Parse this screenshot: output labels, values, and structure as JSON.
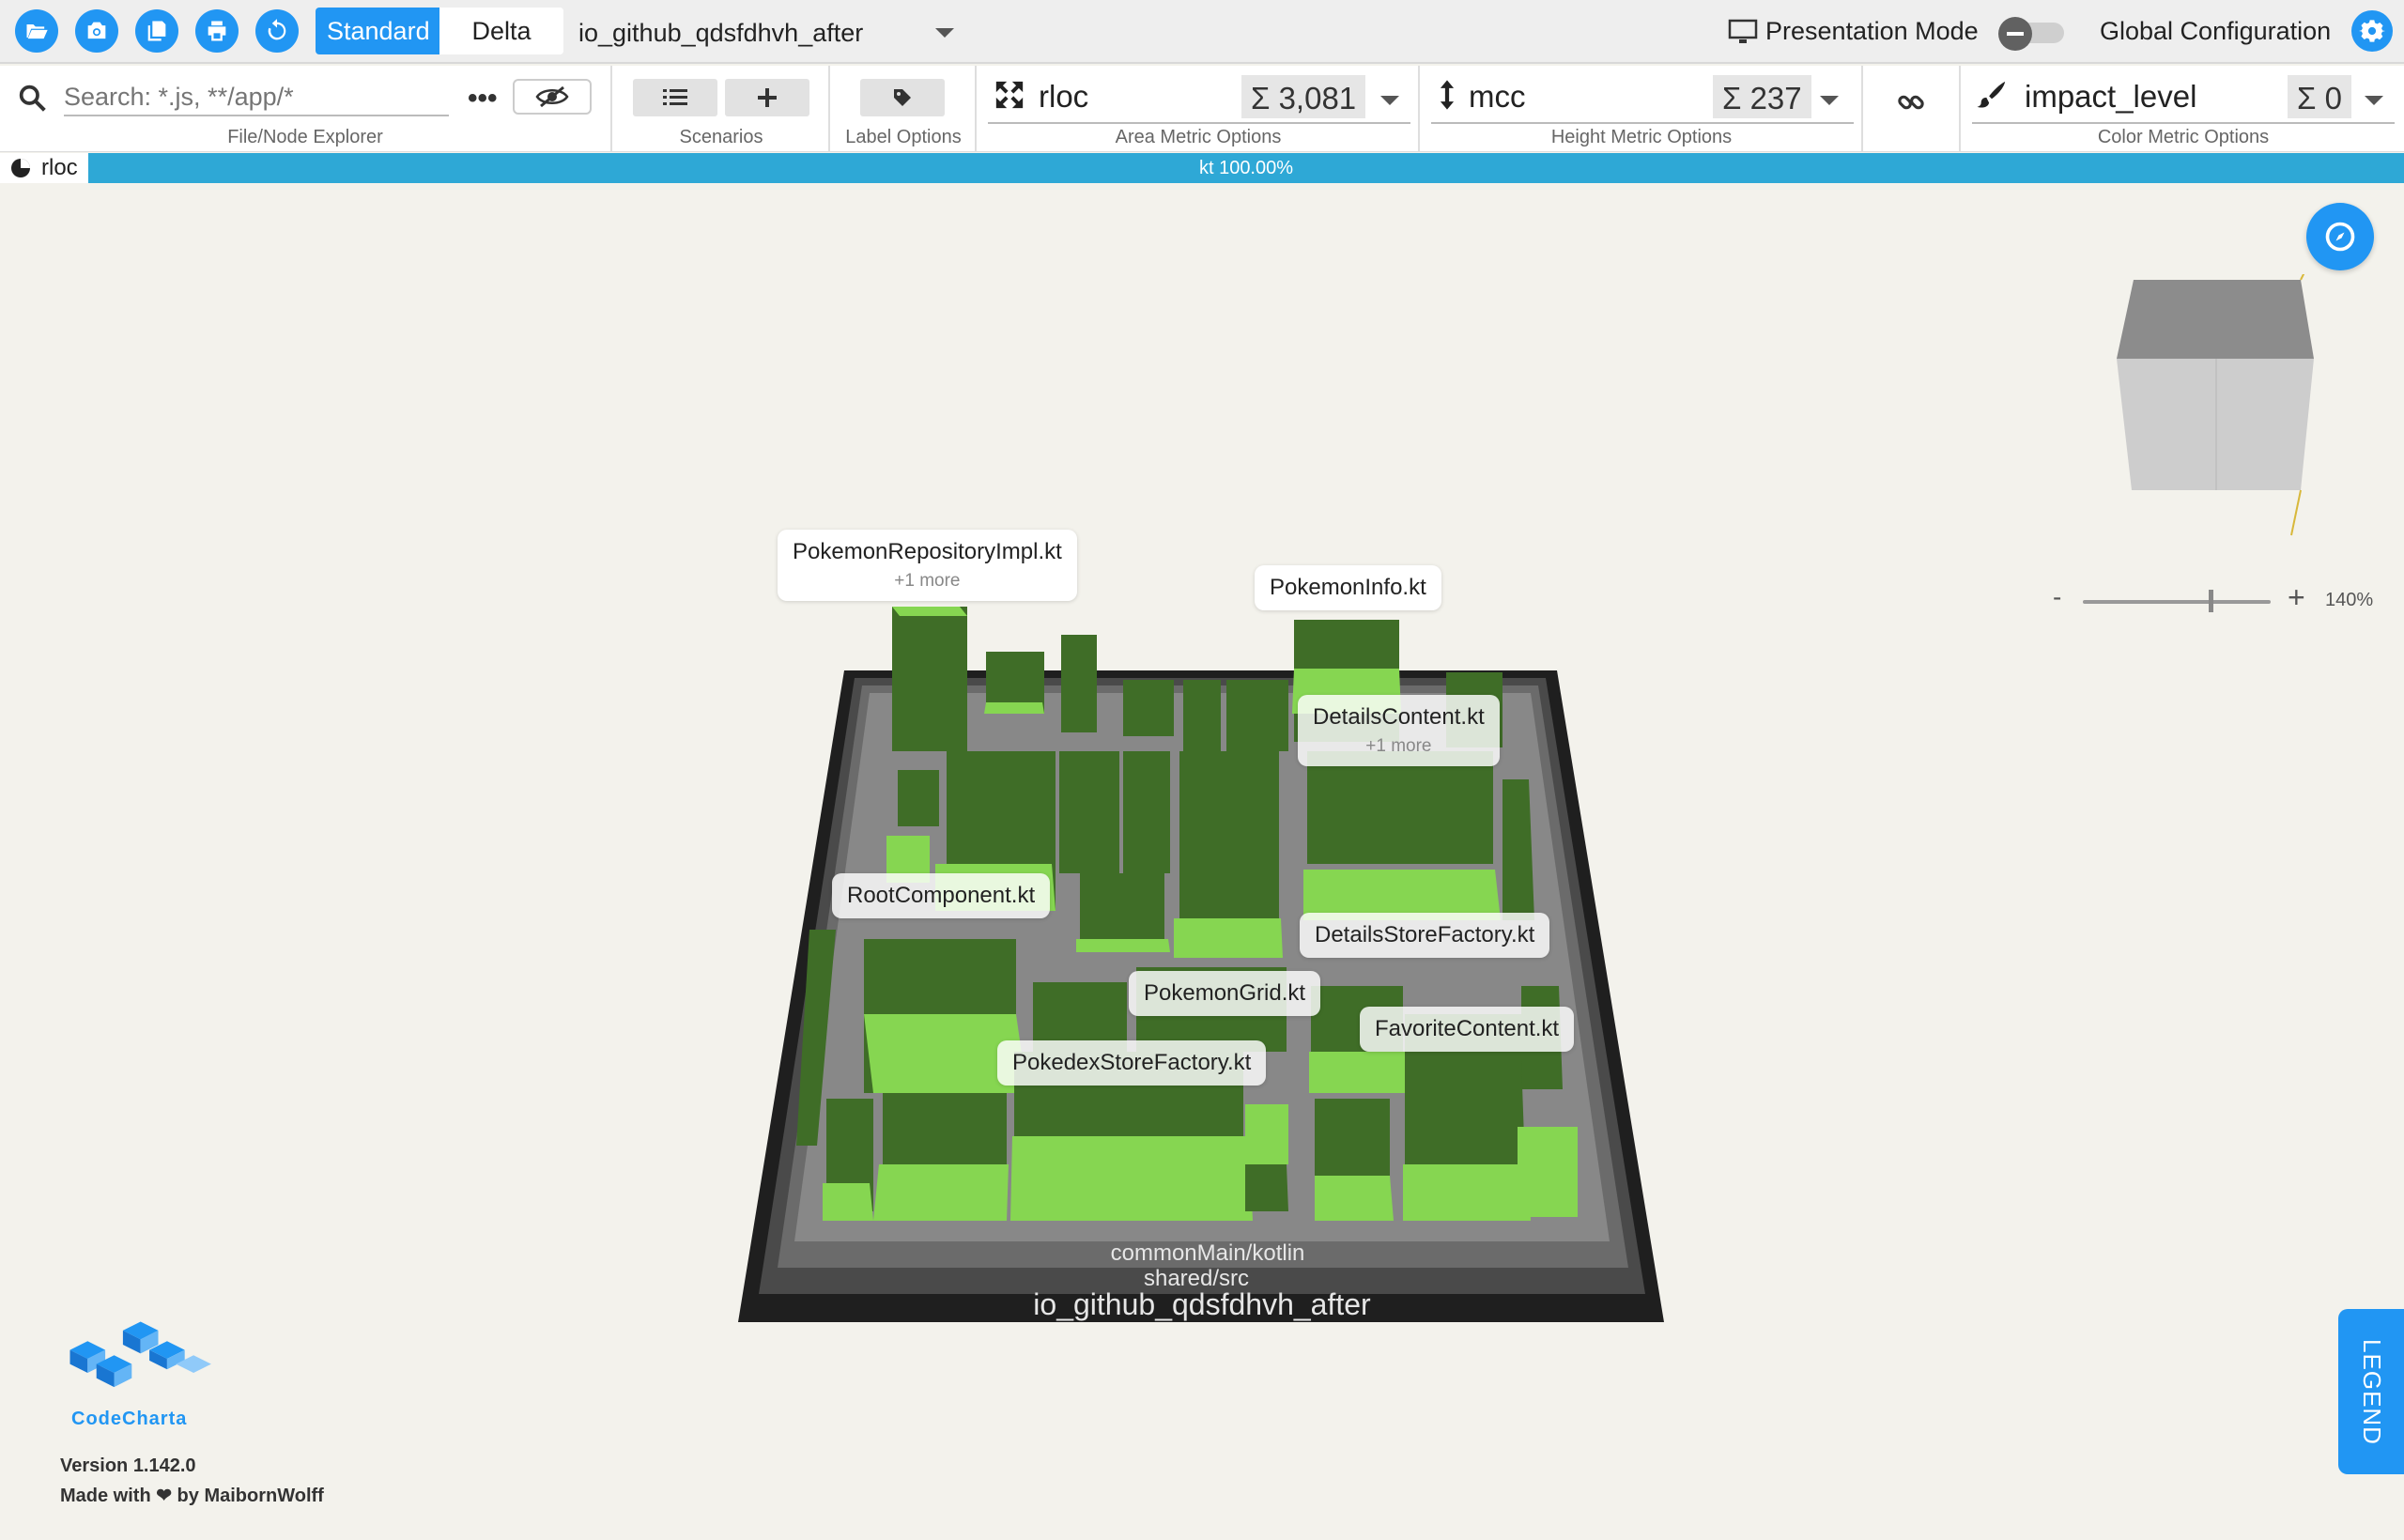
{
  "toolbar": {
    "icons": [
      "folder-open-icon",
      "camera-icon",
      "copy-icon",
      "print-icon",
      "reset-icon"
    ],
    "mode_standard": "Standard",
    "mode_delta": "Delta",
    "selected_file": "io_github_qdsfdhvh_after",
    "presentation_mode_label": "Presentation Mode",
    "presentation_mode_on": false,
    "global_config_label": "Global Configuration"
  },
  "ribbon": {
    "search_placeholder": "Search: *.js, **/app/*",
    "file_explorer_caption": "File/Node Explorer",
    "scenarios_caption": "Scenarios",
    "label_options_caption": "Label Options",
    "area": {
      "metric": "rloc",
      "sum": "Σ 3,081",
      "caption": "Area Metric Options"
    },
    "height": {
      "metric": "mcc",
      "sum": "Σ 237",
      "caption": "Height Metric Options"
    },
    "color": {
      "metric": "impact_level",
      "sum": "Σ 0",
      "caption": "Color Metric Options"
    }
  },
  "progress": {
    "tab_label": "rloc",
    "bar_text": "kt 100.00%",
    "value": 1.0
  },
  "map": {
    "labels": [
      {
        "name": "PokemonRepositoryImpl.kt",
        "more": "+1 more"
      },
      {
        "name": "PokemonInfo.kt"
      },
      {
        "name": "DetailsContent.kt",
        "more": "+1 more"
      },
      {
        "name": "RootComponent.kt"
      },
      {
        "name": "DetailsStoreFactory.kt"
      },
      {
        "name": "PokemonGrid.kt"
      },
      {
        "name": "FavoriteContent.kt"
      },
      {
        "name": "PokedexStoreFactory.kt"
      }
    ],
    "folder_labels": [
      "commonMain/kotlin",
      "shared/src",
      "io_github_qdsfdhvh_after"
    ],
    "colors": {
      "building_top": "#86d651",
      "building_side": "#3f6d27",
      "floor": "#7d7d7d",
      "base": "#2b2b2b"
    }
  },
  "zoom": {
    "minus": "-",
    "plus": "+",
    "percent": "140%",
    "value": 0.67
  },
  "legend_label": "LEGEND",
  "footer": {
    "logo_text": "CodeCharta",
    "version": "Version 1.142.0",
    "made_with": "Made with ❤ by MaibornWolff"
  }
}
